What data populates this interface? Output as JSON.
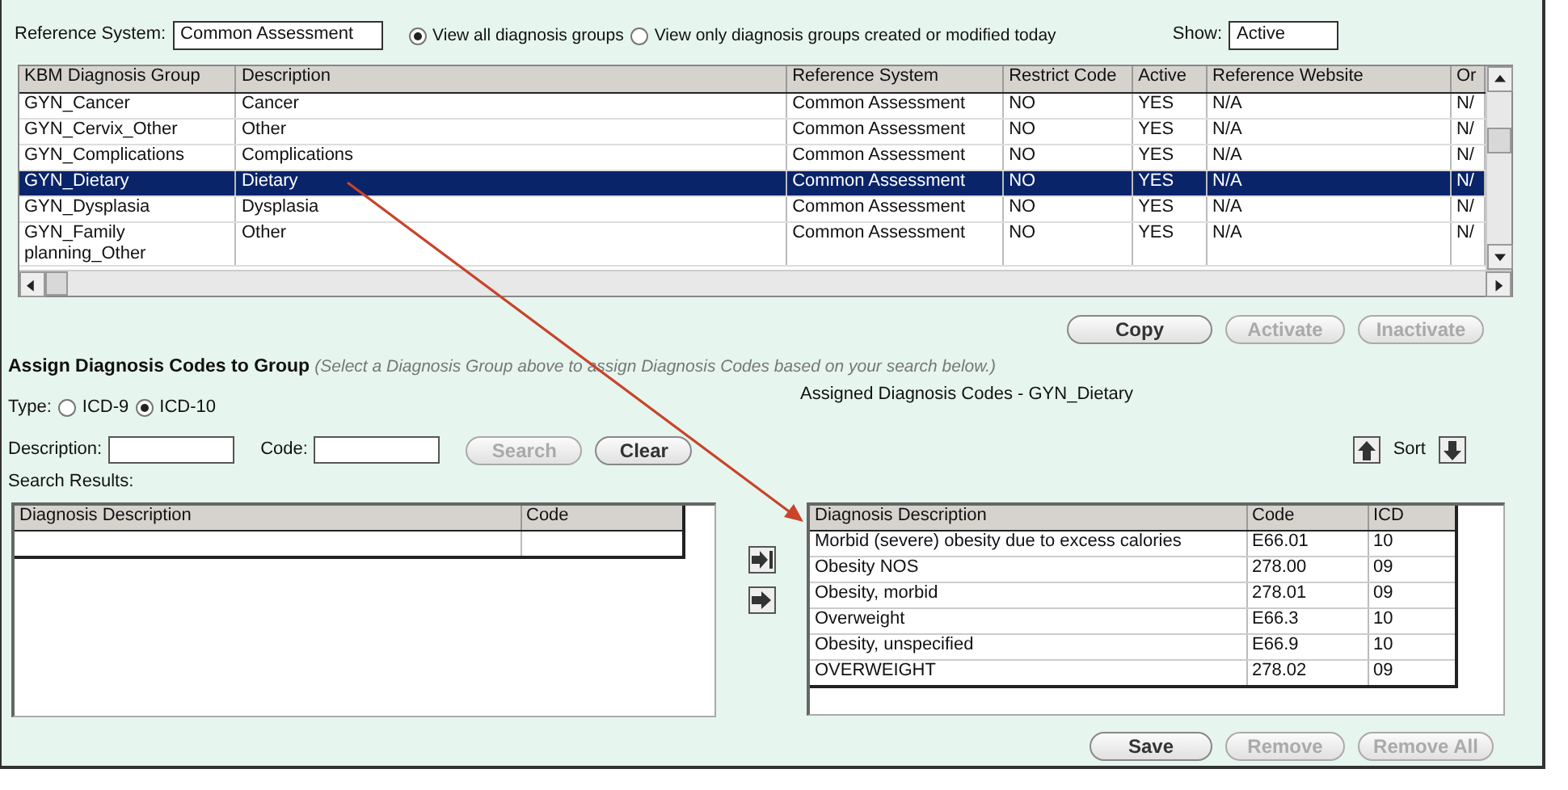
{
  "reference_system": {
    "label": "Reference System:",
    "value": "Common Assessment"
  },
  "view_options": [
    {
      "label": "View all diagnosis groups",
      "selected": true
    },
    {
      "label": "View only diagnosis groups created or modified today",
      "selected": false
    }
  ],
  "show": {
    "label": "Show:",
    "value": "Active"
  },
  "groups_table": {
    "columns": [
      "KBM Diagnosis Group",
      "Description",
      "Reference System",
      "Restrict Code",
      "Active",
      "Reference Website",
      "Or"
    ],
    "rows": [
      {
        "cells": [
          "GYN_Cancer",
          "Cancer",
          "Common Assessment",
          "NO",
          "YES",
          "N/A",
          "N/"
        ],
        "selected": false
      },
      {
        "cells": [
          "GYN_Cervix_Other",
          "Other",
          "Common Assessment",
          "NO",
          "YES",
          "N/A",
          "N/"
        ],
        "selected": false
      },
      {
        "cells": [
          "GYN_Complications",
          "Complications",
          "Common Assessment",
          "NO",
          "YES",
          "N/A",
          "N/"
        ],
        "selected": false
      },
      {
        "cells": [
          "GYN_Dietary",
          "Dietary",
          "Common Assessment",
          "NO",
          "YES",
          "N/A",
          "N/"
        ],
        "selected": true
      },
      {
        "cells": [
          "GYN_Dysplasia",
          "Dysplasia",
          "Common Assessment",
          "NO",
          "YES",
          "N/A",
          "N/"
        ],
        "selected": false
      },
      {
        "cells": [
          "GYN_Family planning_Other",
          "Other",
          "Common Assessment",
          "NO",
          "YES",
          "N/A",
          "N/"
        ],
        "selected": false
      }
    ]
  },
  "group_actions": [
    {
      "label": "Copy",
      "disabled": false
    },
    {
      "label": "Activate",
      "disabled": true
    },
    {
      "label": "Inactivate",
      "disabled": true
    }
  ],
  "assign_section": {
    "title": "Assign Diagnosis Codes to Group",
    "hint": "(Select a Diagnosis Group above to assign Diagnosis Codes based on your search below.)"
  },
  "type": {
    "label": "Type:",
    "options": [
      {
        "label": "ICD-9",
        "selected": false
      },
      {
        "label": "ICD-10",
        "selected": true
      }
    ]
  },
  "search": {
    "description_label": "Description:",
    "code_label": "Code:",
    "buttons": [
      {
        "label": "Search",
        "disabled": true
      },
      {
        "label": "Clear",
        "disabled": false
      }
    ]
  },
  "search_results": {
    "label": "Search Results:",
    "columns": [
      "Diagnosis Description",
      "Code"
    ]
  },
  "assigned": {
    "title": "Assigned Diagnosis Codes - GYN_Dietary",
    "sort_label": "Sort",
    "columns": [
      "Diagnosis Description",
      "Code",
      "ICD"
    ],
    "rows": [
      [
        "Morbid (severe) obesity due to excess calories",
        "E66.01",
        "10"
      ],
      [
        "Obesity NOS",
        "278.00",
        "09"
      ],
      [
        "Obesity, morbid",
        "278.01",
        "09"
      ],
      [
        "Overweight",
        "E66.3",
        "10"
      ],
      [
        "Obesity, unspecified",
        "E66.9",
        "10"
      ],
      [
        "OVERWEIGHT",
        "278.02",
        "09"
      ]
    ]
  },
  "bottom_actions": [
    {
      "label": "Save",
      "disabled": false
    },
    {
      "label": "Remove",
      "disabled": true
    },
    {
      "label": "Remove All",
      "disabled": true
    }
  ]
}
